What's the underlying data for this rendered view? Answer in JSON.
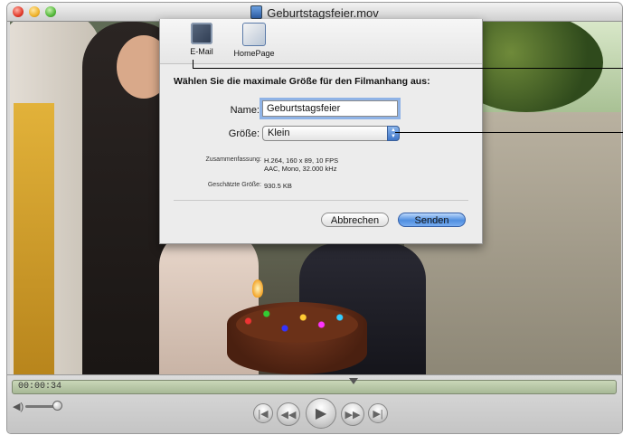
{
  "window": {
    "title": "Geburtstagsfeier.mov"
  },
  "toolbar": {
    "email_label": "E-Mail",
    "homepage_label": "HomePage"
  },
  "dialog": {
    "prompt": "Wählen Sie die maximale Größe für den Filmanhang aus:",
    "name_label": "Name:",
    "name_value": "Geburtstagsfeier",
    "size_label": "Größe:",
    "size_value": "Klein",
    "summary_label": "Zusammenfassung:",
    "summary_line1": "H.264, 160 x 89, 10 FPS",
    "summary_line2": "AAC, Mono, 32.000 kHz",
    "estimate_label": "Geschätzte Größe:",
    "estimate_value": "930.5 KB",
    "cancel_label": "Abbrechen",
    "send_label": "Senden"
  },
  "player": {
    "time": "00:00:34",
    "playhead_fraction": 0.56,
    "volume_fraction": 0.85,
    "icons": [
      "speaker-icon",
      "go-to-start-icon",
      "rewind-icon",
      "play-icon",
      "fast-forward-icon",
      "go-to-end-icon"
    ]
  }
}
